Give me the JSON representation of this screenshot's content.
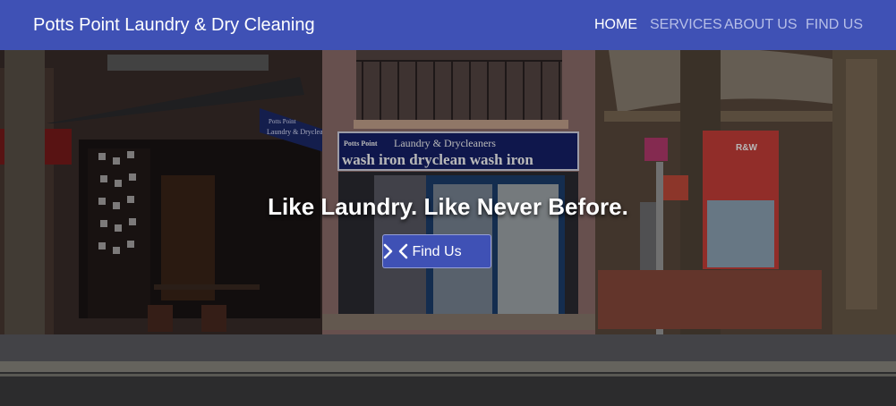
{
  "header": {
    "brand": "Potts Point Laundry & Dry Cleaning",
    "nav": [
      {
        "label": "HOME",
        "active": true
      },
      {
        "label": "SERVICES",
        "active": false
      },
      {
        "label": "ABOUT US",
        "active": false
      },
      {
        "label": "FIND US",
        "active": false
      }
    ]
  },
  "hero": {
    "headline": "Like Laundry. Like Never Before.",
    "cta_label": "Find Us",
    "cta_prev_icon": "chevron-left-icon",
    "cta_next_icon": "chevron-right-icon",
    "storefront_signs": {
      "left_sign_line1": "Potts Point",
      "left_sign_line2": "Laundry & Drycleaners",
      "main_sign_line1": "Potts Point",
      "main_sign_line1b": "Laundry & Drycleaners",
      "main_sign_line2": "wash iron dryclean wash iron",
      "right_poster": "R&W"
    }
  },
  "colors": {
    "primary": "#3f51b5",
    "nav_inactive": "#b7bfe8",
    "nav_active": "#ffffff"
  }
}
